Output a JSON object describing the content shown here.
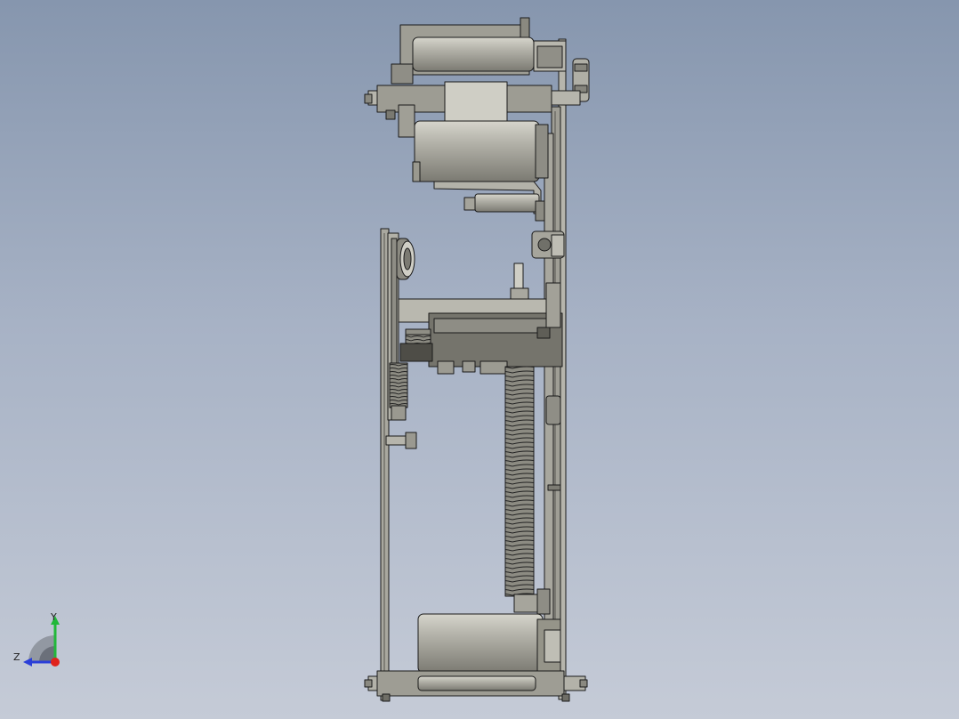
{
  "viewport": {
    "background_top": "#8696ae",
    "background_bottom": "#c5cbd7"
  },
  "model": {
    "description_icon": "mechanism-assembly-side-view",
    "part_fill": "#a4a39a",
    "part_dark": "#6f6e66",
    "part_light": "#cfceC4",
    "edge_color": "#1a1a1a"
  },
  "triad": {
    "y_label": "Y",
    "z_label": "Z",
    "x_color": "#e0221c",
    "y_color": "#22b83a",
    "z_color": "#2a3fd8"
  }
}
